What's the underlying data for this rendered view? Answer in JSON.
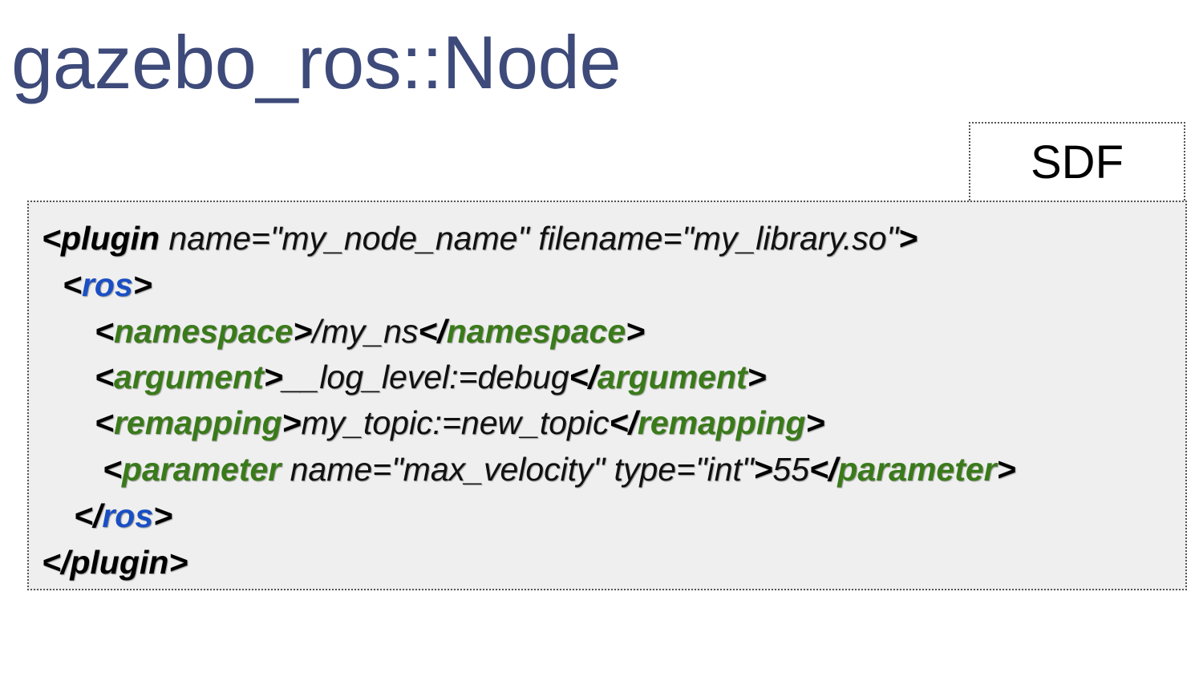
{
  "title": "gazebo_ros::Node",
  "tab": {
    "label": "SDF"
  },
  "colors": {
    "title": "#3d4a7a",
    "ros_tag": "#1a4fc4",
    "child_tag": "#3a7a1a",
    "code_background": "#efefef"
  },
  "code": {
    "plugin_open": {
      "lt": "<",
      "tag": "plugin",
      "attrs": " name=\"my_node_name\" filename=\"my_library.so\"",
      "gt": ">"
    },
    "ros_open": {
      "lt": "<",
      "tag": "ros",
      "gt": ">"
    },
    "namespace": {
      "open_lt": "<",
      "tag": "namespace",
      "open_gt": ">",
      "value": "/my_ns",
      "close_lt": "</",
      "close_tag": "namespace",
      "close_gt": ">"
    },
    "argument": {
      "open_lt": "<",
      "tag": "argument",
      "open_gt": ">",
      "value": "__log_level:=debug",
      "close_lt": "</",
      "close_tag": "argument",
      "close_gt": ">"
    },
    "remapping": {
      "open_lt": "<",
      "tag": "remapping",
      "open_gt": ">",
      "value": "my_topic:=new_topic",
      "close_lt": "</",
      "close_tag": "remapping",
      "close_gt": ">"
    },
    "parameter": {
      "open_lt": "<",
      "tag": "parameter",
      "attrs": " name=\"max_velocity\" type=\"int\"",
      "open_gt": ">",
      "value": "55",
      "close_lt": "</",
      "close_tag": "parameter",
      "close_gt": ">"
    },
    "ros_close": {
      "lt": "</",
      "tag": "ros",
      "gt": ">"
    },
    "plugin_close": {
      "lt": "</",
      "tag": "plugin",
      "gt": ">"
    }
  }
}
